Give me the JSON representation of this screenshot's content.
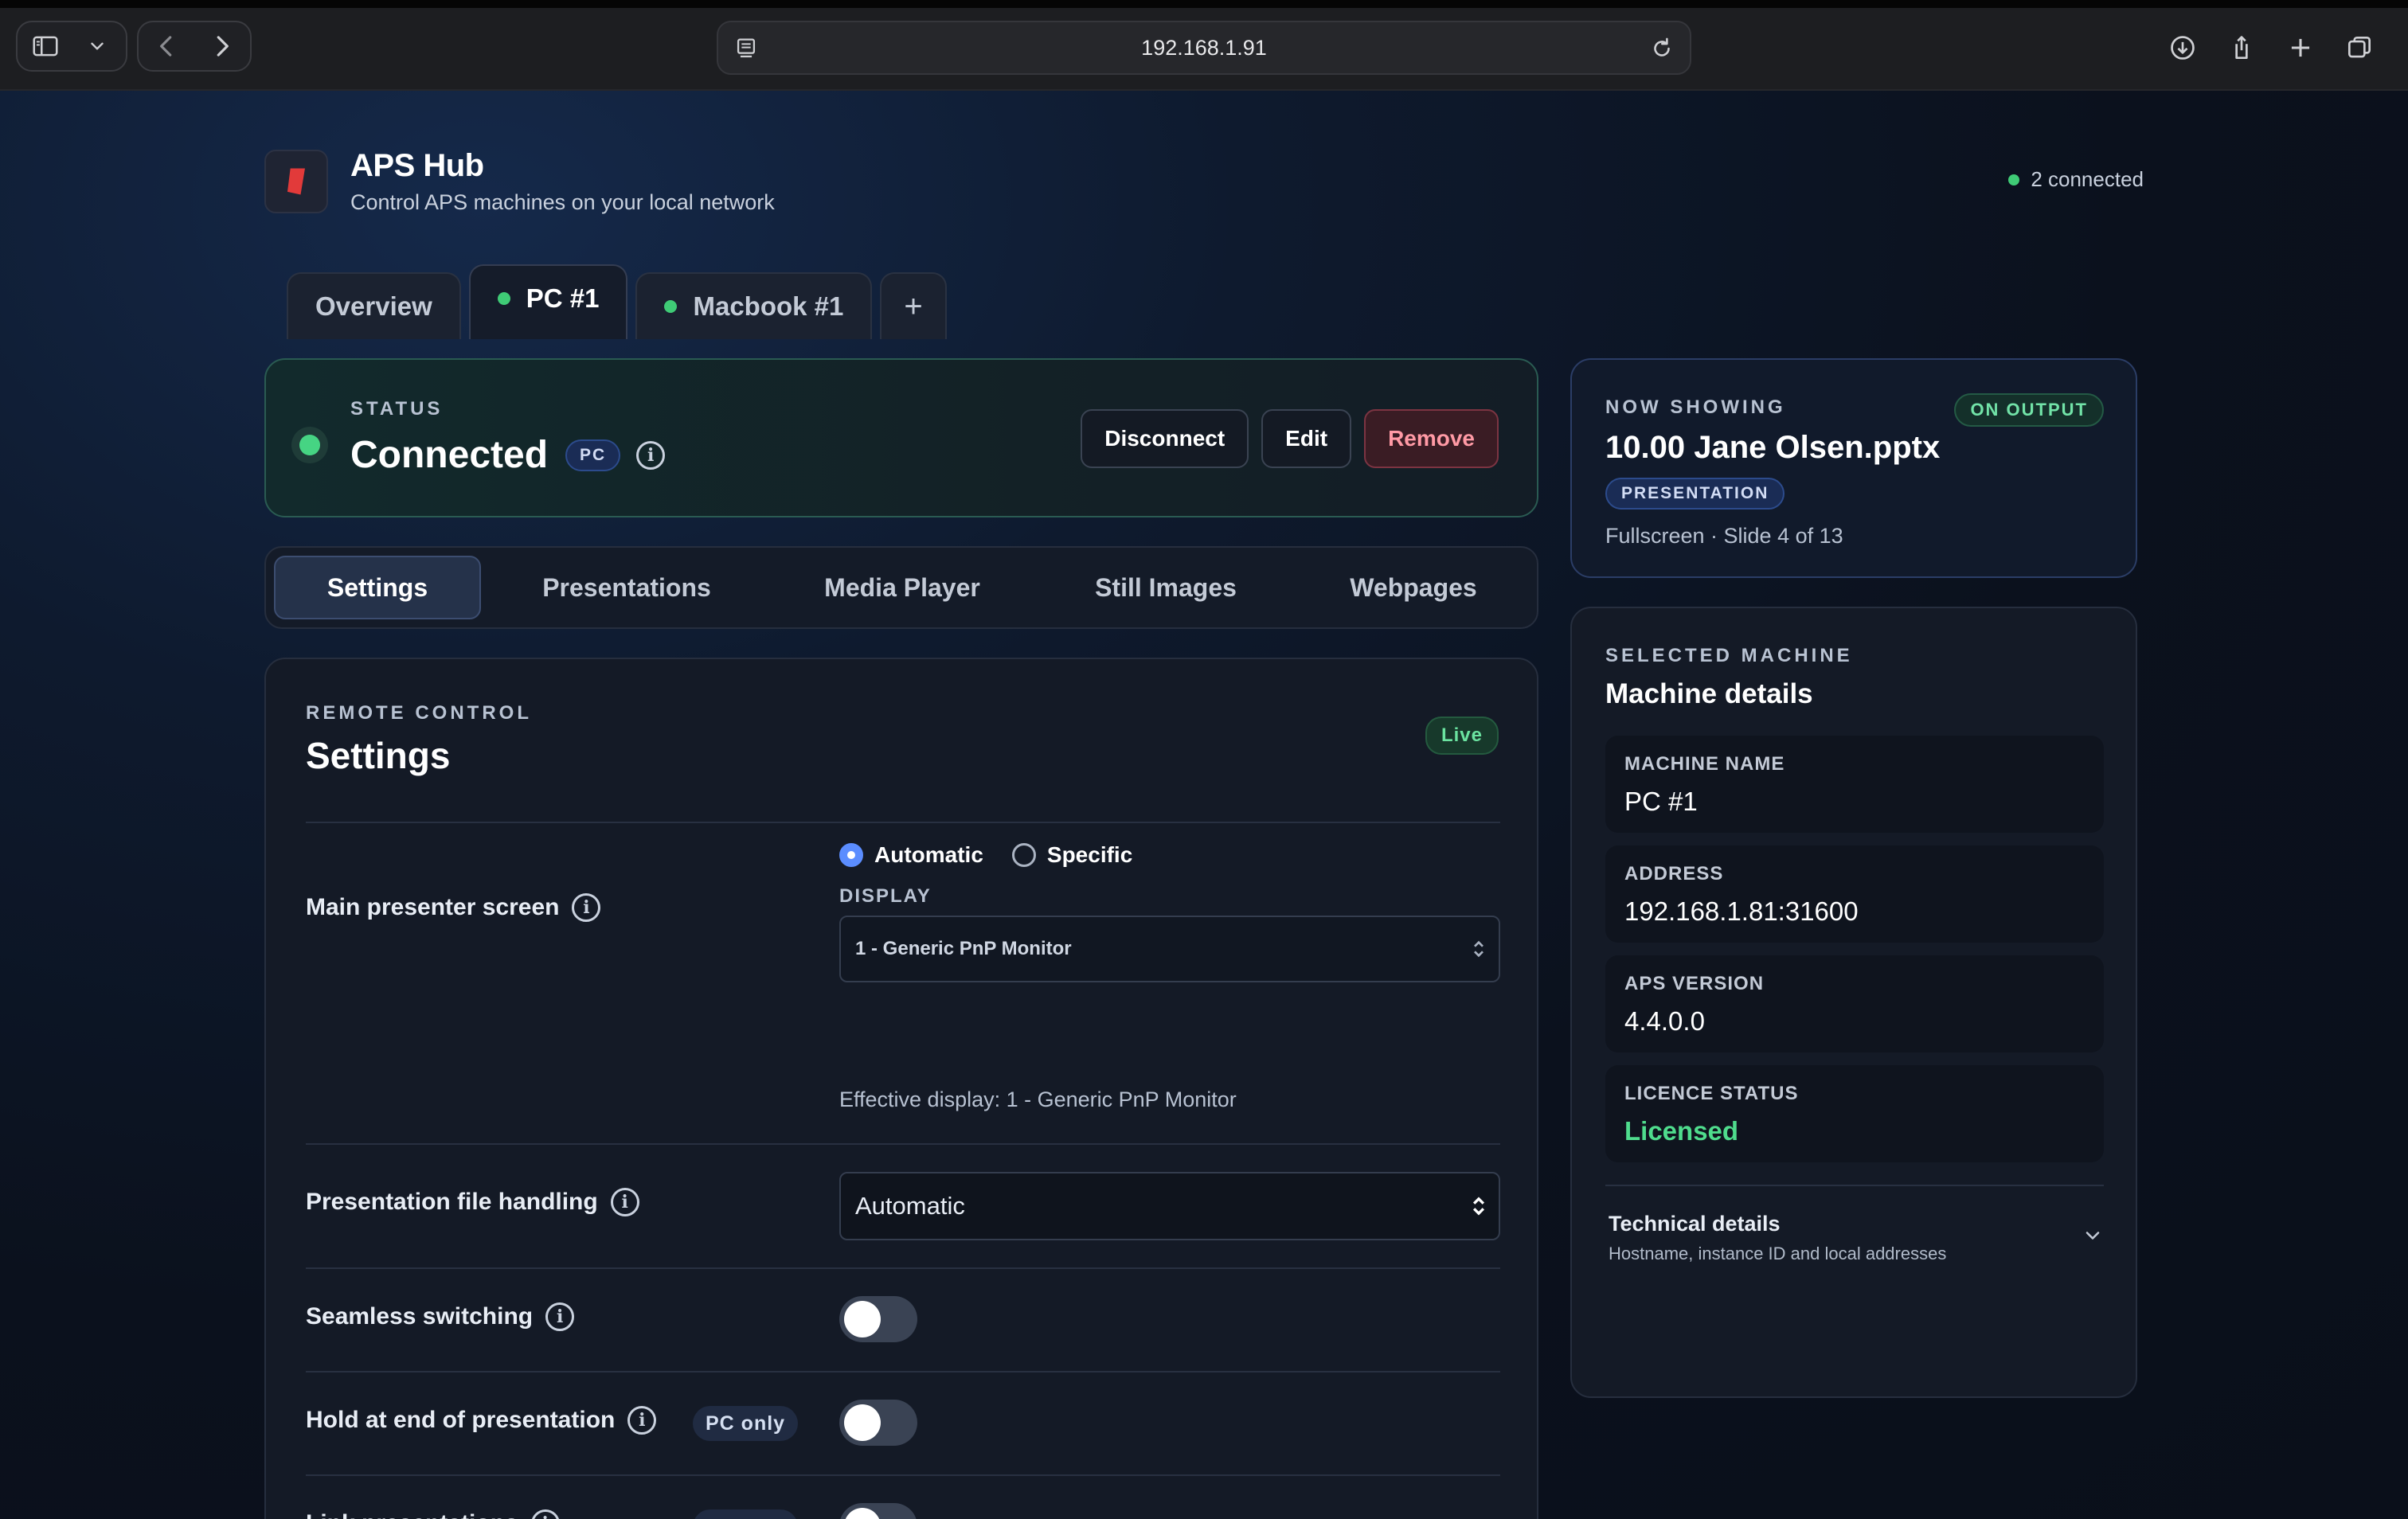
{
  "browser": {
    "url": "192.168.1.91",
    "icons": [
      "sidebar-icon",
      "chevron-down-icon",
      "back-icon",
      "forward-icon",
      "site-settings-icon",
      "reload-icon",
      "download-icon",
      "share-icon",
      "new-tab-icon",
      "tabs-overview-icon"
    ]
  },
  "app": {
    "title": "APS Hub",
    "subtitle": "Control APS machines on your local network",
    "connected_count": "2 connected"
  },
  "machine_tabs": [
    {
      "label": "Overview",
      "connected": false,
      "active": false
    },
    {
      "label": "PC #1",
      "connected": true,
      "active": true
    },
    {
      "label": "Macbook #1",
      "connected": true,
      "active": false
    },
    {
      "label": "+",
      "connected": false,
      "active": false
    }
  ],
  "status": {
    "label": "STATUS",
    "value": "Connected",
    "badge": "PC",
    "info": "i",
    "actions": {
      "disconnect": "Disconnect",
      "edit": "Edit",
      "remove": "Remove"
    }
  },
  "section_tabs": [
    {
      "label": "Settings",
      "active": true
    },
    {
      "label": "Presentations",
      "active": false
    },
    {
      "label": "Media Player",
      "active": false
    },
    {
      "label": "Still Images",
      "active": false
    },
    {
      "label": "Webpages",
      "active": false
    }
  ],
  "settings": {
    "eyebrow": "REMOTE CONTROL",
    "title": "Settings",
    "live_badge": "Live",
    "main_screen": {
      "label": "Main presenter screen",
      "options": [
        "Automatic",
        "Specific"
      ],
      "selected": "Automatic",
      "display_label": "DISPLAY",
      "display_value": "1 - Generic PnP Monitor",
      "effective": "Effective display: 1 - Generic PnP Monitor"
    },
    "file_handling": {
      "label": "Presentation file handling",
      "value": "Automatic"
    },
    "seamless": {
      "label": "Seamless switching",
      "on": false
    },
    "hold_end": {
      "label": "Hold at end of presentation",
      "badge": "PC only",
      "on": false
    },
    "link": {
      "label": "Link presentations",
      "badge": "PC only",
      "on": false
    }
  },
  "now_showing": {
    "eyebrow": "NOW SHOWING",
    "badge": "ON OUTPUT",
    "file": "10.00 Jane Olsen.pptx",
    "type": "PRESENTATION",
    "detail": "Fullscreen · Slide 4 of 13"
  },
  "machine": {
    "eyebrow": "SELECTED MACHINE",
    "title": "Machine details",
    "fields": [
      {
        "key": "MACHINE NAME",
        "value": "PC #1"
      },
      {
        "key": "ADDRESS",
        "value": "192.168.1.81:31600"
      },
      {
        "key": "APS VERSION",
        "value": "4.4.0.0"
      },
      {
        "key": "LICENCE STATUS",
        "value": "Licensed"
      }
    ],
    "technical": {
      "title": "Technical details",
      "subtitle": "Hostname, instance ID and local addresses"
    }
  },
  "colors": {
    "accent": "#5b8dff",
    "connected": "#3fcb76",
    "danger": "#ff9aa5",
    "licensed": "#4fdc8d"
  }
}
